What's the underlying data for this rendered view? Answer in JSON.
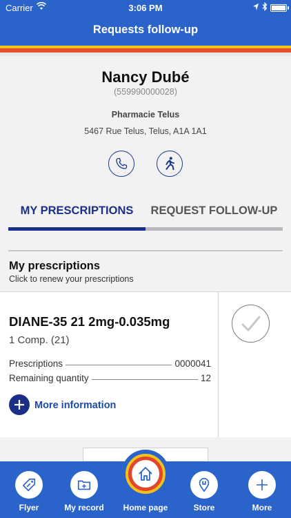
{
  "status_bar": {
    "carrier": "Carrier",
    "time": "3:06 PM"
  },
  "header": {
    "title": "Requests follow-up"
  },
  "patient": {
    "name": "Nancy Dubé",
    "phone": "(559990000028)",
    "pharmacy": "Pharmacie Telus",
    "address": "5467 Rue Telus, Telus, A1A 1A1"
  },
  "actions": {
    "call_icon": "phone-icon",
    "walk_icon": "walking-person-icon"
  },
  "tabs": [
    {
      "label": "MY PRESCRIPTIONS",
      "active": true
    },
    {
      "label": "REQUEST FOLLOW-UP",
      "active": false
    }
  ],
  "section": {
    "title": "My prescriptions",
    "subtitle": "Click to renew your prescriptions"
  },
  "prescription": {
    "drug": "DIANE-35 21 2mg-0.035mg",
    "quantity": "1 Comp. (21)",
    "prescriptions_label": "Prescriptions",
    "prescriptions_value": "0000041",
    "remaining_label": "Remaining quantity",
    "remaining_value": "12",
    "more_info_label": "More information"
  },
  "bottom_nav": {
    "flyer": "Flyer",
    "record": "My record",
    "home": "Home page",
    "store": "Store",
    "more": "More"
  },
  "colors": {
    "header_blue": "#2a63c9",
    "navy": "#1b2f88",
    "yellow": "#f1c21b",
    "red": "#e04e2a"
  }
}
